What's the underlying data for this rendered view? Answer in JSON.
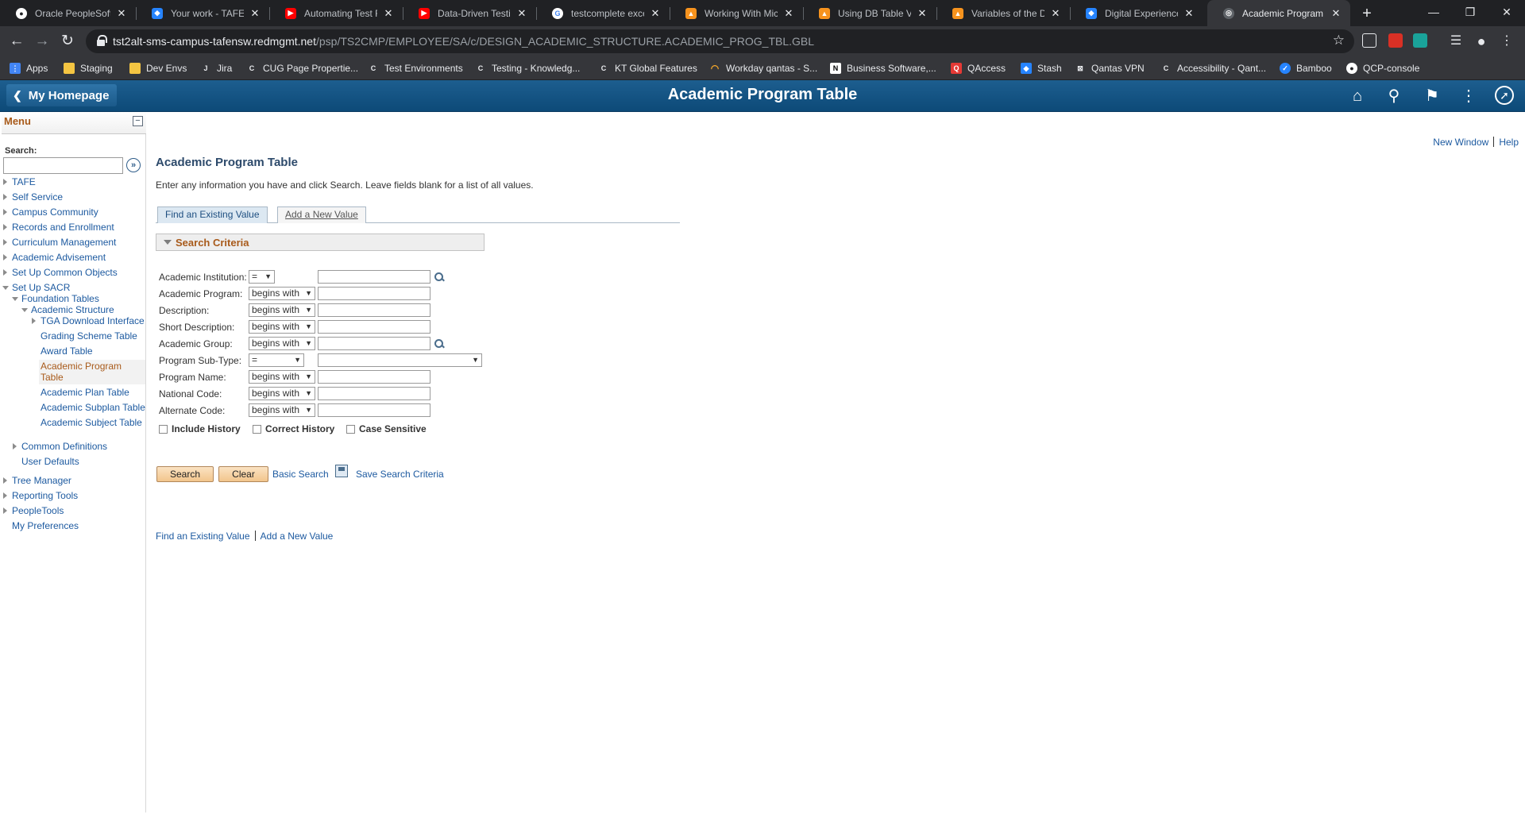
{
  "browser": {
    "tabs": [
      {
        "title": "Oracle PeopleSoft S",
        "icon": "github-icon",
        "color": "#ffffff"
      },
      {
        "title": "Your work - TAFE N",
        "icon": "jira-icon",
        "color": "#2684ff"
      },
      {
        "title": "Automating Test Ru",
        "icon": "youtube-icon",
        "color": "#ff0000"
      },
      {
        "title": "Data-Driven Testing",
        "icon": "youtube-icon",
        "color": "#ff0000"
      },
      {
        "title": "testcomplete excel",
        "icon": "google-icon",
        "color": "#ffffff"
      },
      {
        "title": "Working With Micro",
        "icon": "smartbear-icon",
        "color": "#f7931e"
      },
      {
        "title": "Using DB Table Vari",
        "icon": "smartbear-icon",
        "color": "#f7931e"
      },
      {
        "title": "Variables of the DB",
        "icon": "smartbear-icon",
        "color": "#f7931e"
      },
      {
        "title": "Digital Experience P",
        "icon": "jira-icon",
        "color": "#2684ff"
      },
      {
        "title": "Academic Program",
        "icon": "globe-icon",
        "color": "#9aa0a6"
      }
    ],
    "url_host": "tst2alt-sms-campus-tafensw.redmgmt.net",
    "url_path": "/psp/TS2CMP/EMPLOYEE/SA/c/DESIGN_ACADEMIC_STRUCTURE.ACADEMIC_PROG_TBL.GBL",
    "bookmarks": [
      {
        "label": "Apps",
        "icon": "apps-grid-icon",
        "color": "#4285f4"
      },
      {
        "label": "Staging",
        "icon": "folder-icon",
        "color": "#f4c542"
      },
      {
        "label": "Dev Envs",
        "icon": "folder-icon",
        "color": "#f4c542"
      },
      {
        "label": "Jira",
        "icon": "jira-icon",
        "color": "#e8eaed"
      },
      {
        "label": "CUG Page Propertie...",
        "icon": "confluence-icon",
        "color": "#e8eaed"
      },
      {
        "label": "Test Environments",
        "icon": "confluence-icon",
        "color": "#e8eaed"
      },
      {
        "label": "Testing - Knowledg...",
        "icon": "confluence-icon",
        "color": "#e8eaed"
      },
      {
        "label": "KT Global Features",
        "icon": "confluence-icon",
        "color": "#e8eaed"
      },
      {
        "label": "Workday qantas - S...",
        "icon": "workday-icon",
        "color": "#f4a72a"
      },
      {
        "label": "Business Software,...",
        "icon": "notion-icon",
        "color": "#ffffff"
      },
      {
        "label": "QAccess",
        "icon": "qaccess-icon",
        "color": "#e53935"
      },
      {
        "label": "Stash",
        "icon": "bitbucket-icon",
        "color": "#2684ff"
      },
      {
        "label": "Qantas VPN",
        "icon": "vpn-lock-icon",
        "color": "#e8eaed"
      },
      {
        "label": "Accessibility - Qant...",
        "icon": "confluence-icon",
        "color": "#e8eaed"
      },
      {
        "label": "Bamboo",
        "icon": "bamboo-icon",
        "color": "#2684ff"
      },
      {
        "label": "QCP-console",
        "icon": "github-icon",
        "color": "#ffffff"
      }
    ]
  },
  "header": {
    "home_label": "My Homepage",
    "title": "Academic Program Table",
    "bg_color": "#0d4a78"
  },
  "menu": {
    "title": "Menu",
    "search_label": "Search:",
    "go_icon": "search-go-icon",
    "items": [
      {
        "label": "TAFE"
      },
      {
        "label": "Self Service"
      },
      {
        "label": "Campus Community"
      },
      {
        "label": "Records and Enrollment"
      },
      {
        "label": "Curriculum Management"
      },
      {
        "label": "Academic Advisement"
      },
      {
        "label": "Set Up Common Objects"
      },
      {
        "label": "Set Up SACR"
      },
      {
        "label": "Foundation Tables"
      },
      {
        "label": "Academic Structure"
      },
      {
        "label": "TGA Download Interface"
      },
      {
        "label": "Grading Scheme Table"
      },
      {
        "label": "Award Table"
      },
      {
        "label": "Academic Program"
      },
      {
        "label": "Table"
      },
      {
        "label": "Academic Plan Table"
      },
      {
        "label": "Academic Subplan Table"
      },
      {
        "label": "Academic Subject Table"
      },
      {
        "label": "Common Definitions"
      },
      {
        "label": "User Defaults"
      },
      {
        "label": "Tree Manager"
      },
      {
        "label": "Reporting Tools"
      },
      {
        "label": "PeopleTools"
      },
      {
        "label": "My Preferences"
      }
    ]
  },
  "content": {
    "new_window": "New Window",
    "help": "Help",
    "page_title": "Academic Program Table",
    "instructions": "Enter any information you have and click Search. Leave fields blank for a list of all values.",
    "tab_find": "Find an Existing Value",
    "tab_add": "Add a New Value",
    "criteria_title": "Search Criteria",
    "fields": [
      {
        "label": "Academic Institution:",
        "op": "=",
        "value": ""
      },
      {
        "label": "Academic Program:",
        "op": "begins with",
        "value": ""
      },
      {
        "label": "Description:",
        "op": "begins with",
        "value": ""
      },
      {
        "label": "Short Description:",
        "op": "begins with",
        "value": ""
      },
      {
        "label": "Academic Group:",
        "op": "begins with",
        "value": ""
      },
      {
        "label": "Program Sub-Type:",
        "op": "=",
        "value": ""
      },
      {
        "label": "Program Name:",
        "op": "begins with",
        "value": ""
      },
      {
        "label": "National Code:",
        "op": "begins with",
        "value": ""
      },
      {
        "label": "Alternate Code:",
        "op": "begins with",
        "value": ""
      }
    ],
    "checkboxes": [
      {
        "label": "Include History",
        "checked": false
      },
      {
        "label": "Correct History",
        "checked": false
      },
      {
        "label": "Case Sensitive",
        "checked": false
      }
    ],
    "search_btn": "Search",
    "clear_btn": "Clear",
    "basic_search": "Basic Search",
    "save_search": "Save Search Criteria",
    "bottom_find": "Find an Existing Value",
    "bottom_add": "Add a New Value",
    "accent_color": "#a85a1a",
    "link_color": "#1d5aa0"
  }
}
